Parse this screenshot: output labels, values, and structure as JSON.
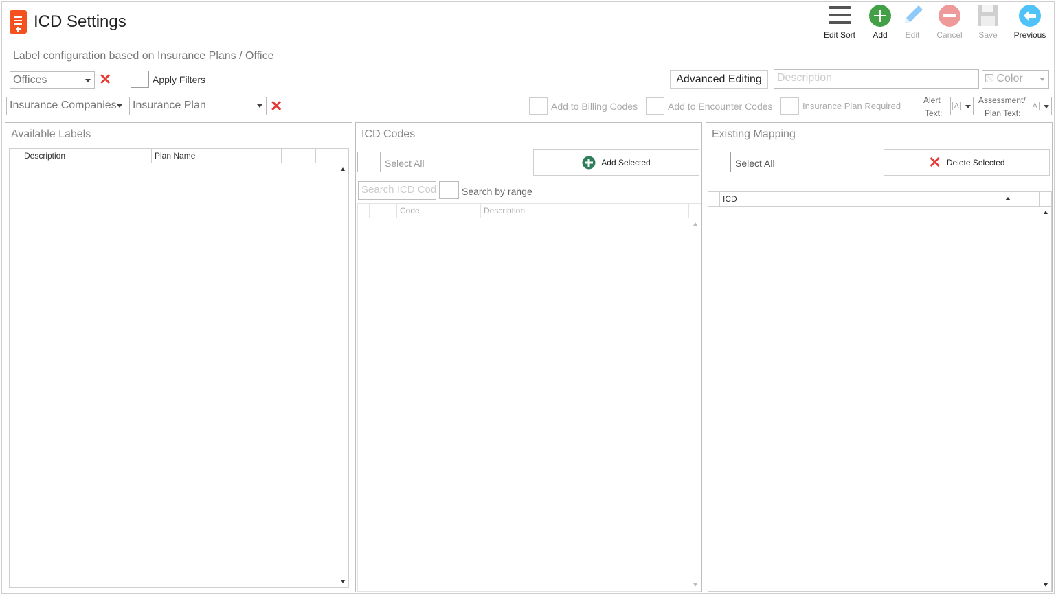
{
  "header": {
    "title": "ICD Settings",
    "subtitle": "Label configuration based on Insurance Plans / Office"
  },
  "toolbar": {
    "edit_sort": "Edit Sort",
    "add": "Add",
    "edit": "Edit",
    "cancel": "Cancel",
    "save": "Save",
    "previous": "Previous"
  },
  "filters": {
    "offices": "Offices",
    "apply_filters": "Apply Filters",
    "insurance_companies": "Insurance Companies",
    "insurance_plan": "Insurance Plan"
  },
  "advanced": {
    "button": "Advanced Editing",
    "description_placeholder": "Description",
    "color": "Color",
    "add_billing": "Add to Billing Codes",
    "add_encounter": "Add to Encounter Codes",
    "plan_required": "Insurance Plan Required",
    "alert_text_1": "Alert",
    "alert_text_2": "Text:",
    "assessment_text_1": "Assessment/",
    "assessment_text_2": "Plan Text:"
  },
  "available_labels": {
    "title": "Available Labels",
    "columns": [
      "Description",
      "Plan Name"
    ]
  },
  "icd_codes": {
    "title": "ICD Codes",
    "select_all": "Select All",
    "add_selected": "Add Selected",
    "search_placeholder": "Search ICD Codes",
    "search_by_range": "Search by range",
    "columns": [
      "Code",
      "Description"
    ]
  },
  "existing_mapping": {
    "title": "Existing Mapping",
    "select_all": "Select All",
    "delete_selected": "Delete Selected",
    "columns": [
      "ICD"
    ]
  },
  "colors": {
    "accent_orange": "#f4511e",
    "add_green": "#43a047",
    "edit_blue": "#90caf9",
    "cancel_red": "#ef9a9a",
    "previous_teal": "#4fc3f7",
    "close_red": "#e53935"
  }
}
